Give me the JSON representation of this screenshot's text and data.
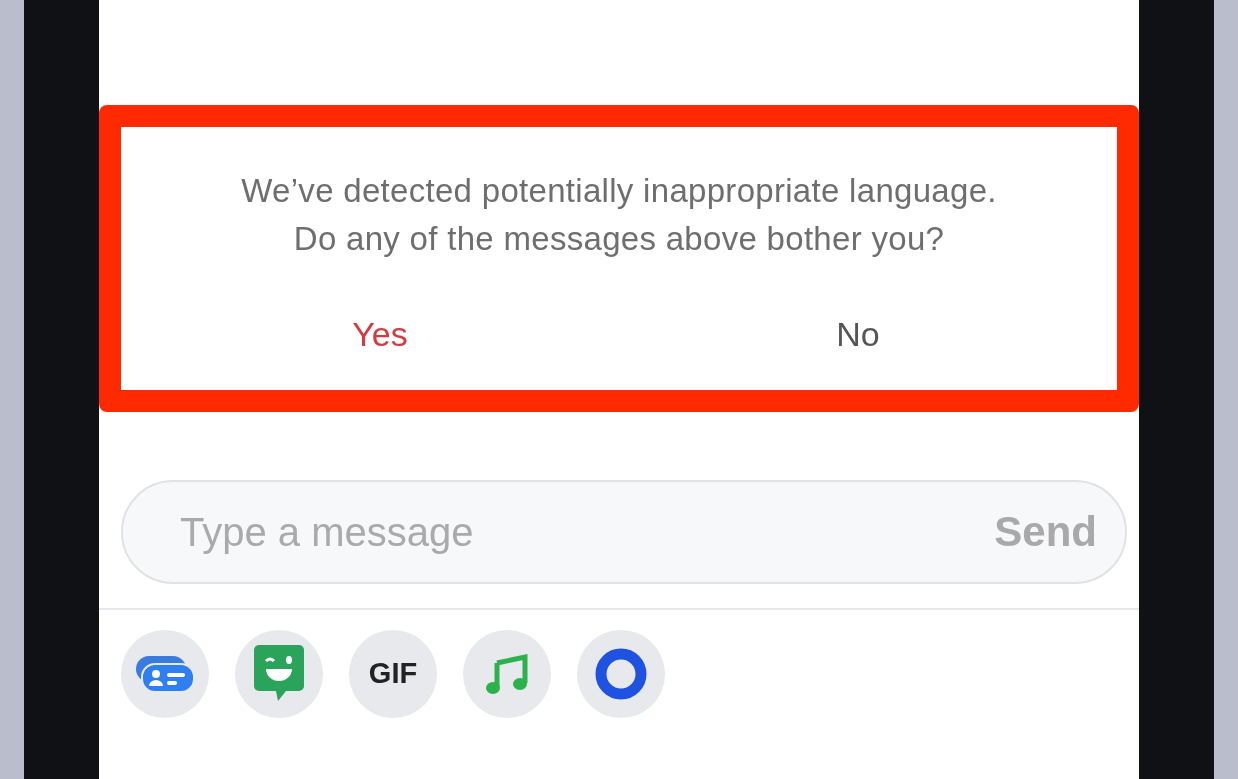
{
  "prompt": {
    "message": "We’ve detected potentially inappropriate language.\nDo any of the messages above bother you?",
    "actions": [
      {
        "label": "Yes",
        "kind": "danger"
      },
      {
        "label": "No",
        "kind": "plain"
      }
    ]
  },
  "composer": {
    "placeholder": "Type a message",
    "send_label": "Send"
  },
  "toolbar": {
    "gif_label": "GIF"
  }
}
